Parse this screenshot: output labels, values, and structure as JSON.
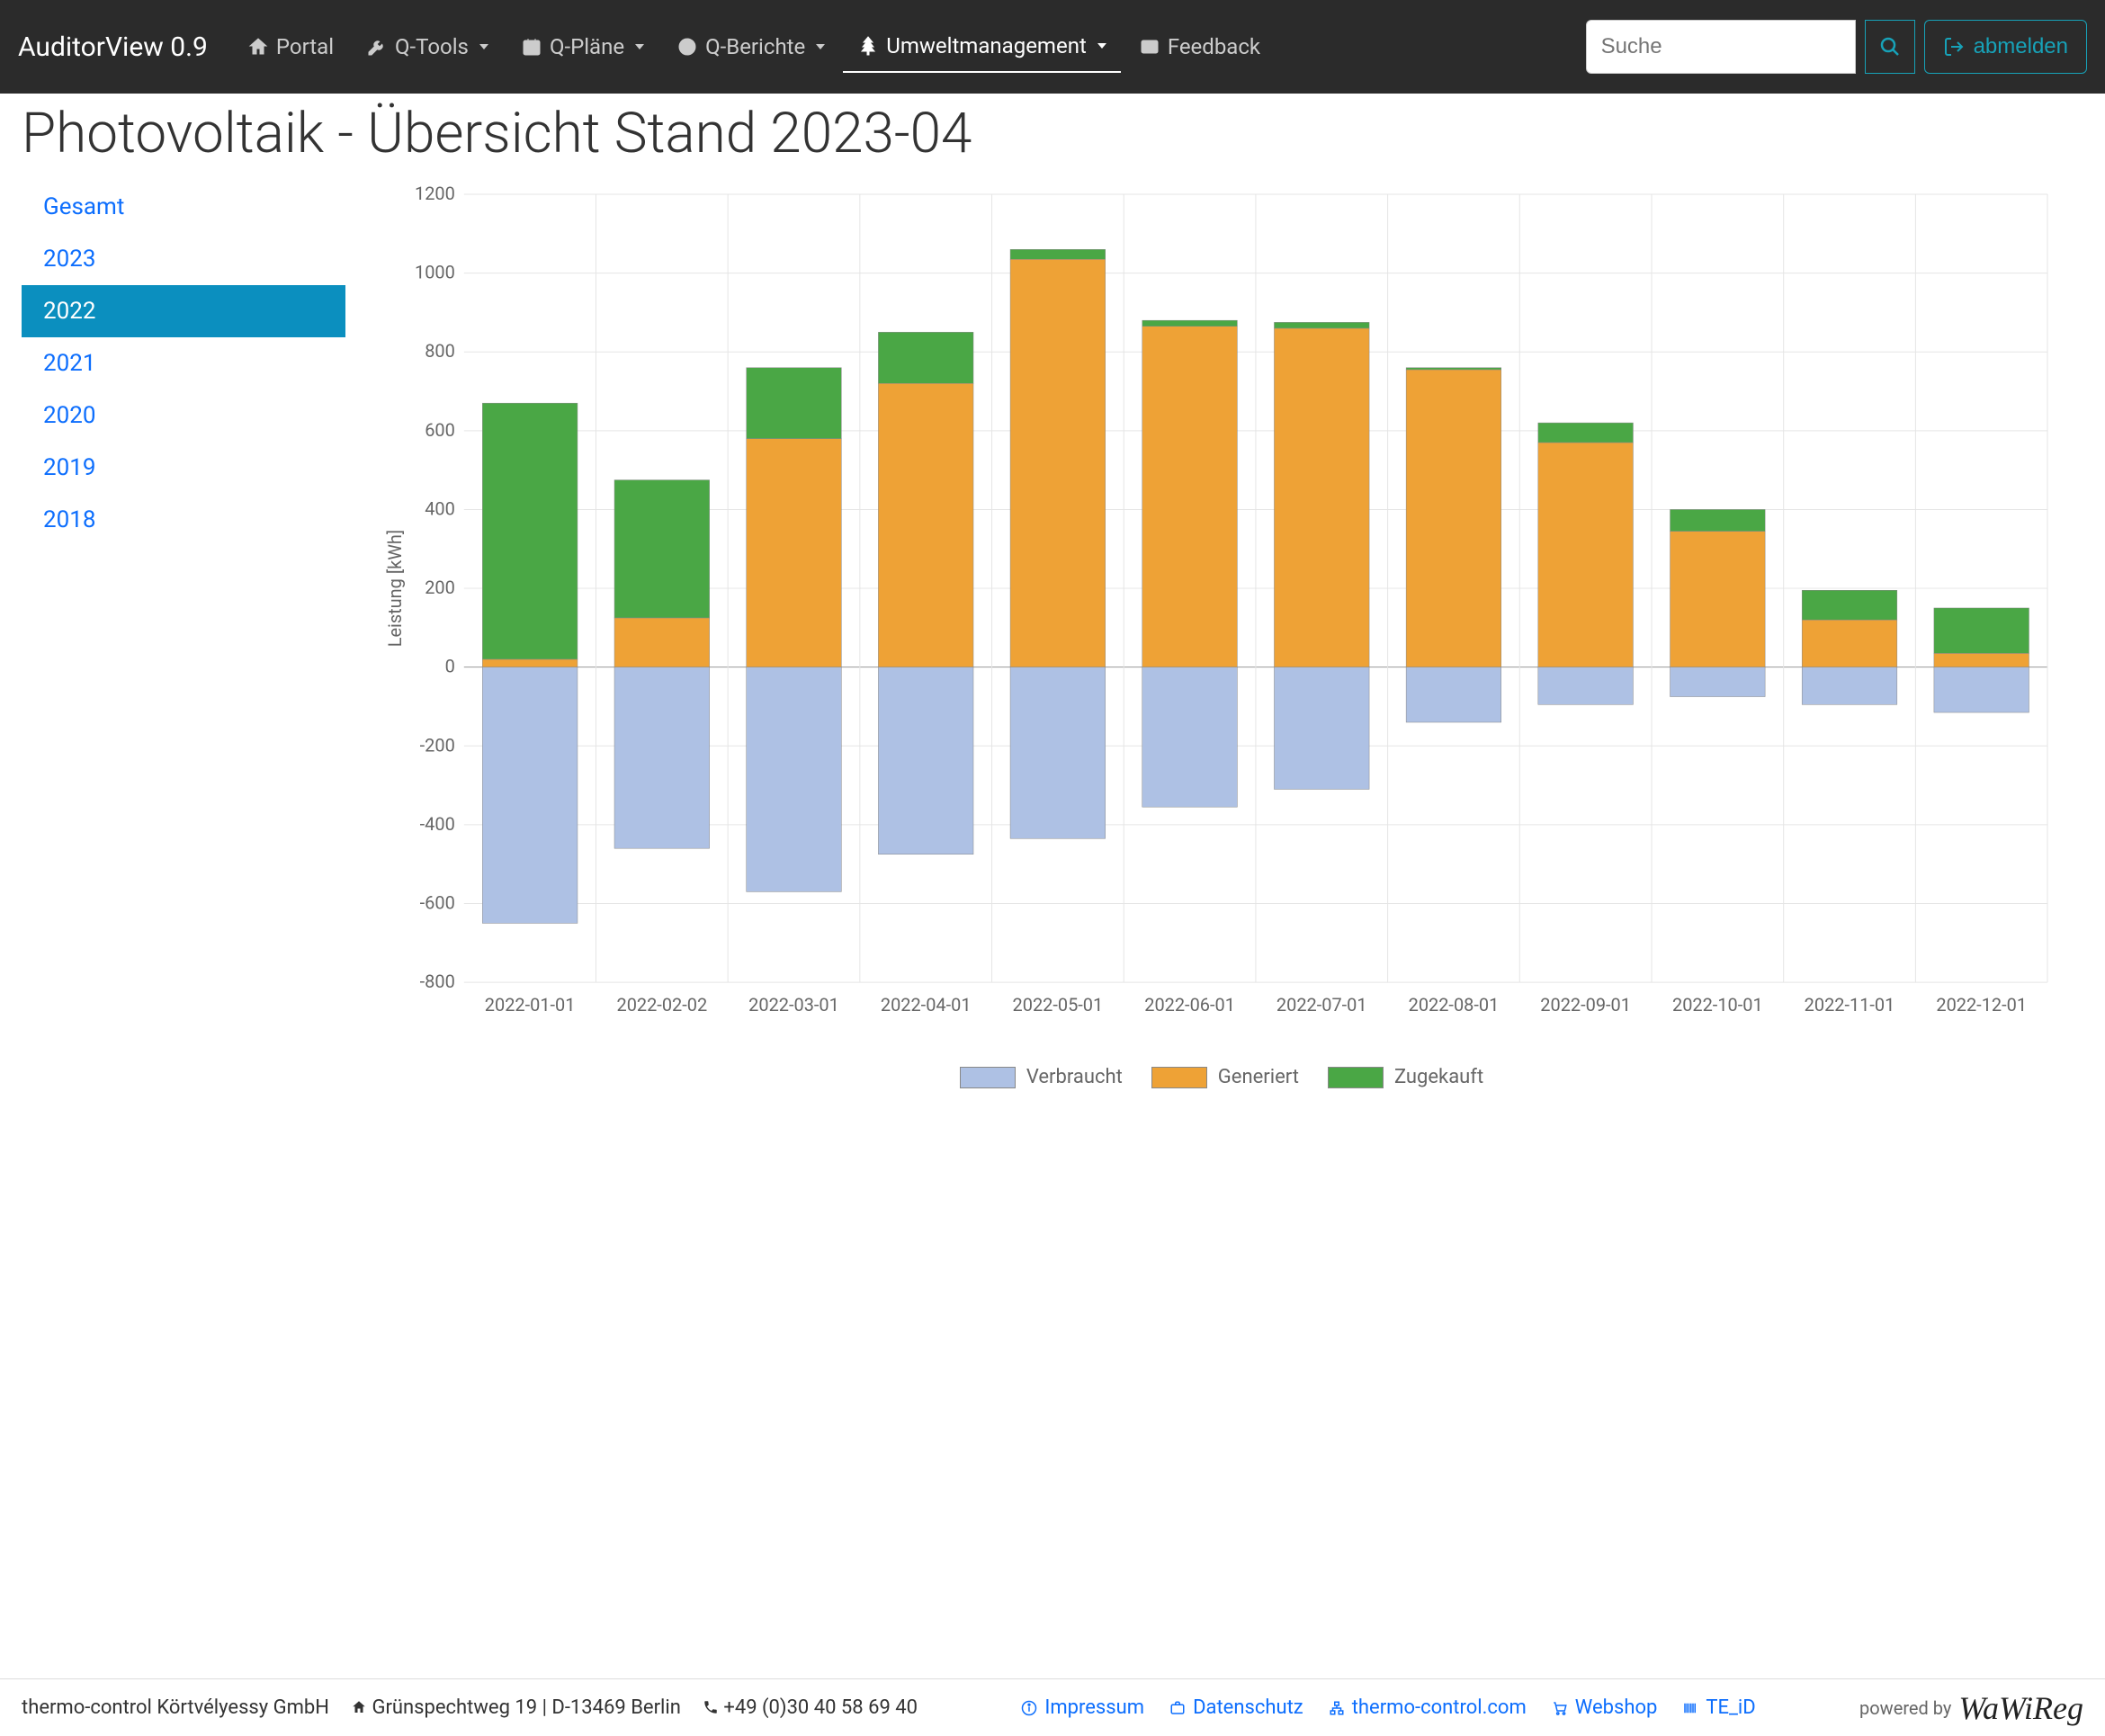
{
  "nav": {
    "brand": "AuditorView 0.9",
    "items": [
      {
        "icon": "home",
        "label": "Portal"
      },
      {
        "icon": "wrench",
        "label": "Q-Tools",
        "dropdown": true
      },
      {
        "icon": "calendar",
        "label": "Q-Pläne",
        "dropdown": true
      },
      {
        "icon": "chart",
        "label": "Q-Berichte",
        "dropdown": true
      },
      {
        "icon": "tree",
        "label": "Umweltmanagement",
        "dropdown": true,
        "active": true
      },
      {
        "icon": "mail",
        "label": "Feedback"
      }
    ],
    "search_placeholder": "Suche",
    "logout": "abmelden"
  },
  "page": {
    "title": "Photovoltaik - Übersicht Stand 2023-04"
  },
  "sidebar": {
    "items": [
      {
        "label": "Gesamt"
      },
      {
        "label": "2023"
      },
      {
        "label": "2022",
        "active": true
      },
      {
        "label": "2021"
      },
      {
        "label": "2020"
      },
      {
        "label": "2019"
      },
      {
        "label": "2018"
      }
    ]
  },
  "chart_data": {
    "type": "bar",
    "stacked": true,
    "xlabel": "",
    "ylabel": "Leistung [kWh]",
    "ylim": [
      -800,
      1200
    ],
    "yticks": [
      -800,
      -600,
      -400,
      -200,
      0,
      200,
      400,
      600,
      800,
      1000,
      1200
    ],
    "categories": [
      "2022-01-01",
      "2022-02-02",
      "2022-03-01",
      "2022-04-01",
      "2022-05-01",
      "2022-06-01",
      "2022-07-01",
      "2022-08-01",
      "2022-09-01",
      "2022-10-01",
      "2022-11-01",
      "2022-12-01"
    ],
    "series": [
      {
        "name": "Verbraucht",
        "color": "#aec1e4",
        "values": [
          -650,
          -460,
          -570,
          -475,
          -435,
          -355,
          -310,
          -140,
          -95,
          -75,
          -95,
          -115
        ]
      },
      {
        "name": "Generiert",
        "color": "#eea236",
        "values": [
          20,
          125,
          580,
          720,
          1035,
          865,
          860,
          755,
          570,
          345,
          120,
          35
        ]
      },
      {
        "name": "Zugekauft",
        "color": "#4aa745",
        "values": [
          650,
          350,
          180,
          130,
          25,
          15,
          15,
          5,
          50,
          55,
          75,
          115
        ]
      }
    ],
    "legend": [
      "Verbraucht",
      "Generiert",
      "Zugekauft"
    ]
  },
  "footer": {
    "company": "thermo-control Körtvélyessy GmbH",
    "address": "Grünspechtweg 19 | D-13469 Berlin",
    "phone": "+49 (0)30 40 58 69 40",
    "links": [
      {
        "icon": "info",
        "label": "Impressum"
      },
      {
        "icon": "briefcase",
        "label": "Datenschutz"
      },
      {
        "icon": "sitemap",
        "label": "thermo-control.com"
      },
      {
        "icon": "cart",
        "label": "Webshop"
      },
      {
        "icon": "barcode",
        "label": "TE_iD"
      }
    ],
    "powered": "powered by",
    "brand": "WaWiReg"
  }
}
